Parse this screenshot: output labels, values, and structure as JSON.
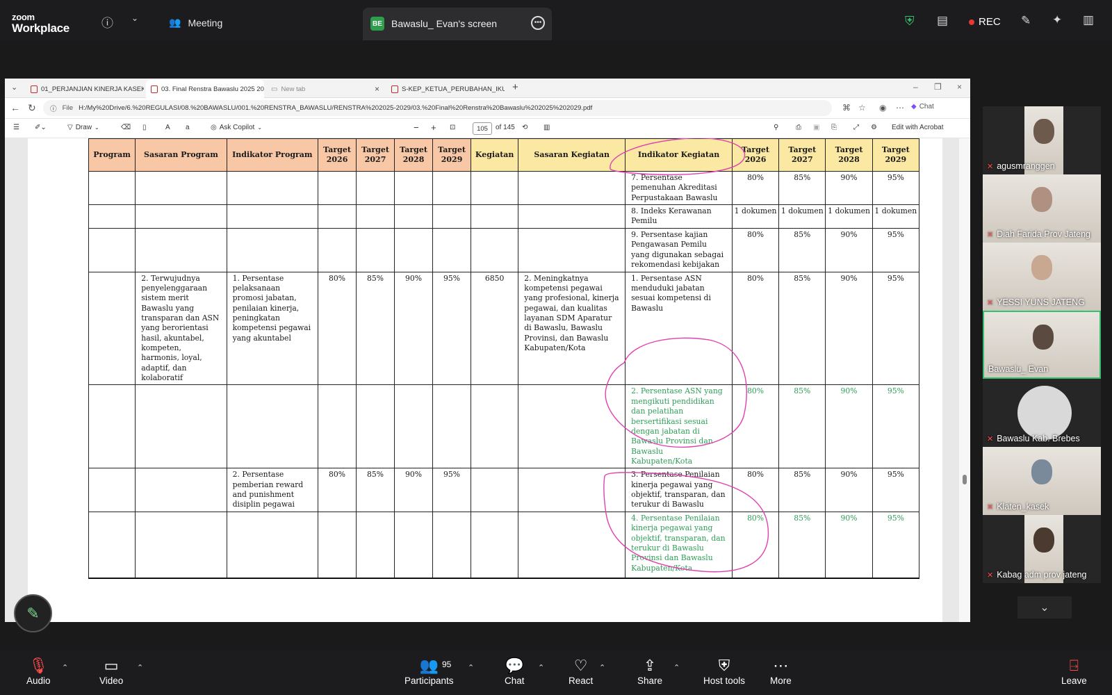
{
  "zoom": {
    "logo_top": "zoom",
    "logo_bottom": "Workplace",
    "meeting_label": "Meeting",
    "share_badge": "BE",
    "share_label": "Bawaslu_ Evan's screen",
    "rec_label": "REC"
  },
  "browser": {
    "tabs": [
      {
        "label": "01_PERJANJIAN KINERJA KASEK K"
      },
      {
        "label": "03. Final Renstra Bawaslu 2025 20"
      },
      {
        "label": "New tab"
      },
      {
        "label": "S-KEP_KETUA_PERUBAHAN_IKU 2"
      }
    ],
    "address_prefix": "File",
    "address": "H:/My%20Drive/6.%20REGULASI/08.%20BAWASLU/001.%20RENSTRA_BAWASLU/RENSTRA%202025-2029/03.%20Final%20Renstra%20Bawaslu%202025%202029.pdf",
    "chat_label": "Chat"
  },
  "pdf_toolbar": {
    "draw_label": "Draw",
    "copilot_label": "Ask Copilot",
    "page_current": "105",
    "page_total": "of 145",
    "acrobat_label": "Edit with Acrobat"
  },
  "table": {
    "headers": [
      "Program",
      "Sasaran Program",
      "Indikator Program",
      "Target 2026",
      "Target 2027",
      "Target 2028",
      "Target 2029",
      "Kegiatan",
      "Sasaran Kegiatan",
      "Indikator Kegiatan",
      "Target 2026",
      "Target 2027",
      "Target 2028",
      "Target 2029"
    ],
    "rows": [
      {
        "cells": [
          "",
          "",
          "",
          "",
          "",
          "",
          "",
          "",
          "",
          "7. Persentase pemenuhan Akreditasi Perpustakaan Bawaslu",
          "80%",
          "85%",
          "90%",
          "95%"
        ],
        "green": false
      },
      {
        "cells": [
          "",
          "",
          "",
          "",
          "",
          "",
          "",
          "",
          "",
          "8. Indeks Kerawanan Pemilu",
          "1 dokumen",
          "1 dokumen",
          "1 dokumen",
          "1 dokumen"
        ],
        "green": false
      },
      {
        "cells": [
          "",
          "",
          "",
          "",
          "",
          "",
          "",
          "",
          "",
          "9. Persentase kajian Pengawasan Pemilu yang digunakan sebagai rekomendasi kebijakan",
          "80%",
          "85%",
          "90%",
          "95%"
        ],
        "green": false
      },
      {
        "cells": [
          "",
          "2. Terwujudnya penyelenggaraan sistem merit Bawaslu yang transparan dan ASN yang berorientasi hasil, akuntabel, kompeten, harmonis, loyal, adaptif, dan kolaboratif",
          "1. Persentase pelaksanaan promosi jabatan, penilaian kinerja, peningkatan kompetensi pegawai yang akuntabel",
          "80%",
          "85%",
          "90%",
          "95%",
          "6850",
          "2. Meningkatnya kompetensi pegawai yang profesional, kinerja pegawai, dan kualitas layanan SDM Aparatur di Bawaslu, Bawaslu Provinsi, dan Bawaslu Kabupaten/Kota",
          "1. Persentase ASN menduduki jabatan sesuai kompetensi di Bawaslu",
          "80%",
          "85%",
          "90%",
          "95%"
        ],
        "green": false
      },
      {
        "cells": [
          "",
          "",
          "",
          "",
          "",
          "",
          "",
          "",
          "",
          "2. Persentase ASN yang mengikuti pendidikan dan pelatihan bersertifikasi sesuai dengan jabatan di Bawaslu Provinsi dan Bawaslu Kabupaten/Kota",
          "80%",
          "85%",
          "90%",
          "95%"
        ],
        "green": true
      },
      {
        "cells": [
          "",
          "",
          "2. Persentase pemberian reward and punishment disiplin pegawai",
          "80%",
          "85%",
          "90%",
          "95%",
          "",
          "",
          "3. Persentase Penilaian kinerja pegawai yang objektif, transparan, dan terukur di Bawaslu",
          "80%",
          "85%",
          "90%",
          "95%"
        ],
        "green": false
      },
      {
        "cells": [
          "",
          "",
          "",
          "",
          "",
          "",
          "",
          "",
          "",
          "4. Persentase Penilaian kinerja pegawai yang objektif, transparan, dan terukur di Bawaslu Provinsi dan Bawaslu Kabupaten/Kota",
          "80%",
          "85%",
          "90%",
          "95%"
        ],
        "green": true
      }
    ]
  },
  "gallery": [
    {
      "name": "agusmranggen",
      "muted": true
    },
    {
      "name": "Diah Farida Prov Jateng",
      "muted": true
    },
    {
      "name": "YESSI YUNS JATENG",
      "muted": true
    },
    {
      "name": "Bawaslu_ Evan",
      "muted": false
    },
    {
      "name": "Bawaslu Kab. Brebes",
      "muted": true
    },
    {
      "name": "Klaten_kasek",
      "muted": true
    },
    {
      "name": "Kabag adm prov jateng",
      "muted": true
    }
  ],
  "bottom_bar": {
    "audio": "Audio",
    "video": "Video",
    "participants": "Participants",
    "participant_count": "95",
    "chat": "Chat",
    "react": "React",
    "share": "Share",
    "host_tools": "Host tools",
    "more": "More",
    "leave": "Leave"
  },
  "colors": {
    "header_orange": "#f7c7a6",
    "header_yellow": "#fbe8a3",
    "green_text": "#2e9e57",
    "pen_annotation": "#e040b0",
    "active_speaker": "#36c06e"
  }
}
